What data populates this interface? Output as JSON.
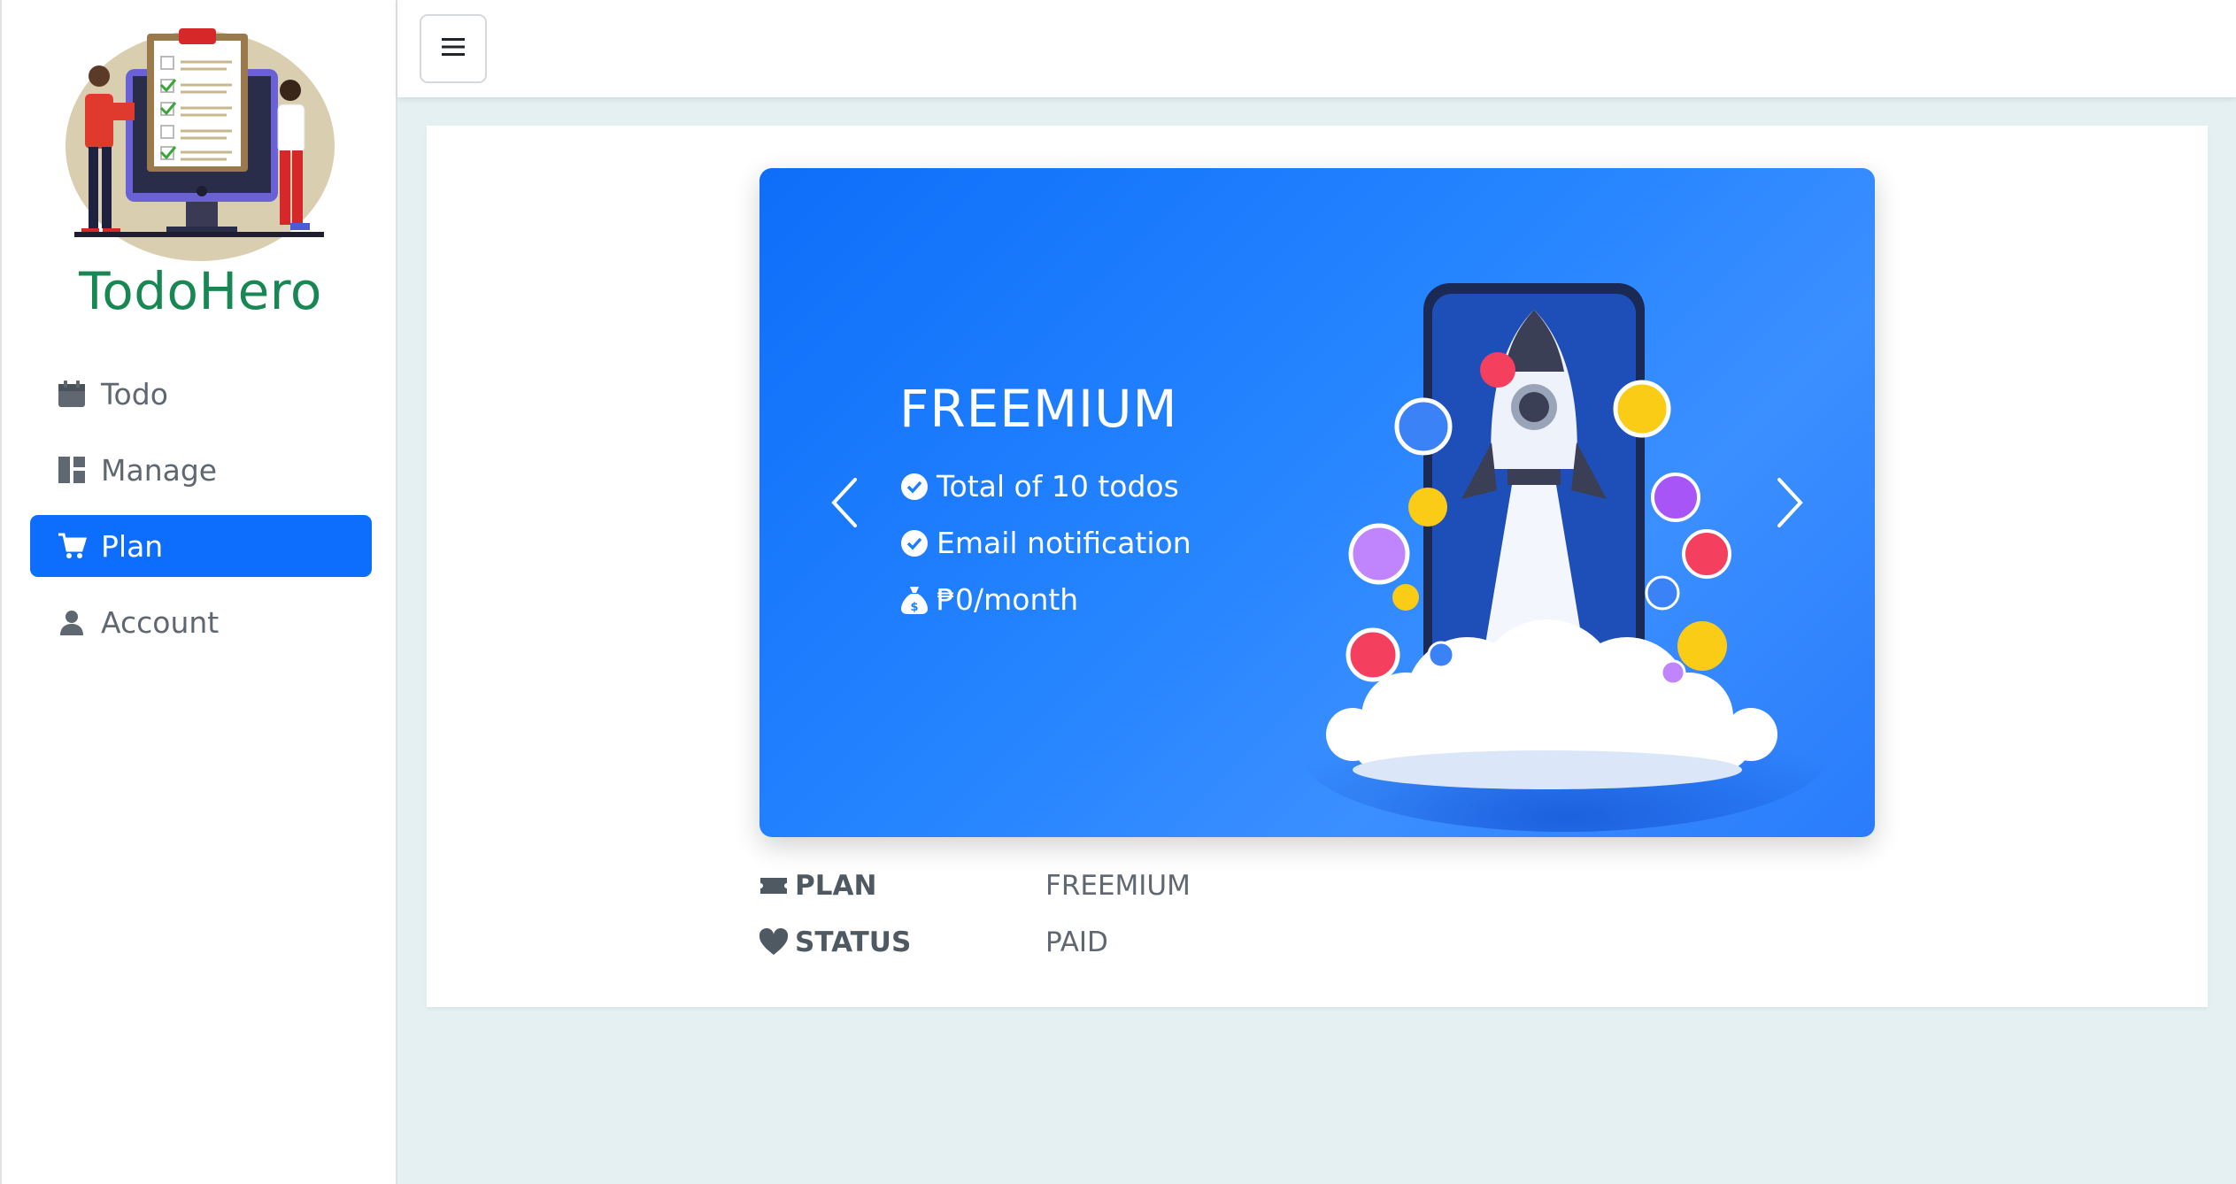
{
  "sidebar": {
    "brand": "TodoHero",
    "items": [
      {
        "label": "Todo",
        "icon": "calendar-icon",
        "active": false
      },
      {
        "label": "Manage",
        "icon": "dashboard-icon",
        "active": false
      },
      {
        "label": "Plan",
        "icon": "cart-icon",
        "active": true
      },
      {
        "label": "Account",
        "icon": "user-icon",
        "active": false
      }
    ]
  },
  "topbar": {
    "toggle_icon": "hamburger-icon"
  },
  "carousel": {
    "title": "FREEMIUM",
    "features": [
      {
        "icon": "check-circle-icon",
        "text": "Total of 10 todos"
      },
      {
        "icon": "check-circle-icon",
        "text": "Email notification"
      },
      {
        "icon": "money-bag-icon",
        "text": "₱0/month"
      }
    ],
    "prev_icon": "chevron-left-icon",
    "next_icon": "chevron-right-icon"
  },
  "details": {
    "plan_label": "PLAN",
    "plan_value": "FREEMIUM",
    "status_label": "STATUS",
    "status_value": "PAID"
  },
  "colors": {
    "brand": "#198754",
    "accent": "#0d6efd",
    "card_bg": "#1f7dfc",
    "page_bg": "#e4f0f2"
  }
}
